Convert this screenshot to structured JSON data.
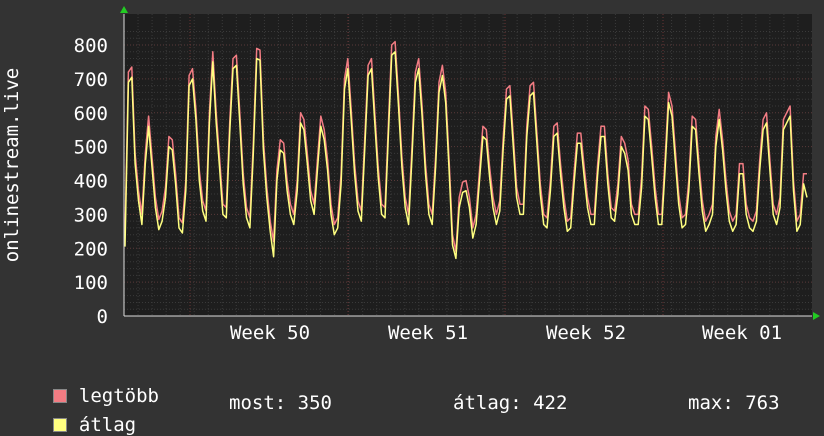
{
  "chart_data": {
    "type": "line",
    "ylabel": "onlinestream.live",
    "ylim": [
      0,
      850
    ],
    "yticks": [
      0,
      100,
      200,
      300,
      400,
      500,
      600,
      700,
      800
    ],
    "xtick_labels": [
      "Week 50",
      "Week 51",
      "Week 52",
      "Week 01"
    ],
    "grid": true,
    "series": [
      {
        "name": "legtöbb",
        "color": "#f27c83",
        "values": [
          245,
          720,
          735,
          480,
          370,
          300,
          480,
          590,
          470,
          350,
          285,
          310,
          380,
          530,
          520,
          420,
          290,
          275,
          400,
          710,
          730,
          610,
          430,
          340,
          310,
          600,
          780,
          600,
          470,
          330,
          320,
          570,
          760,
          770,
          600,
          420,
          320,
          290,
          510,
          790,
          785,
          520,
          380,
          280,
          220,
          430,
          520,
          510,
          400,
          330,
          300,
          400,
          600,
          580,
          480,
          370,
          330,
          460,
          590,
          550,
          460,
          330,
          270,
          290,
          420,
          700,
          760,
          610,
          450,
          340,
          310,
          520,
          740,
          760,
          600,
          440,
          330,
          320,
          560,
          800,
          810,
          650,
          470,
          350,
          300,
          500,
          720,
          760,
          620,
          450,
          330,
          300,
          470,
          690,
          740,
          660,
          460,
          240,
          190,
          350,
          395,
          400,
          350,
          260,
          300,
          430,
          560,
          550,
          440,
          350,
          300,
          340,
          520,
          670,
          680,
          530,
          380,
          330,
          330,
          560,
          680,
          690,
          540,
          390,
          300,
          290,
          400,
          560,
          570,
          450,
          350,
          280,
          290,
          420,
          540,
          540,
          440,
          350,
          300,
          300,
          450,
          560,
          560,
          420,
          320,
          310,
          390,
          530,
          510,
          460,
          330,
          300,
          300,
          410,
          620,
          610,
          500,
          380,
          300,
          300,
          470,
          660,
          620,
          490,
          360,
          290,
          300,
          400,
          590,
          580,
          450,
          340,
          280,
          300,
          330,
          530,
          610,
          520,
          400,
          310,
          280,
          300,
          450,
          450,
          330,
          290,
          280,
          310,
          460,
          580,
          600,
          460,
          330,
          300,
          350,
          580,
          600,
          620,
          400,
          280,
          300,
          420,
          420
        ]
      },
      {
        "name": "átlag",
        "color": "#ffff80",
        "values": [
          205,
          690,
          705,
          450,
          340,
          270,
          450,
          560,
          440,
          320,
          255,
          280,
          350,
          500,
          490,
          390,
          260,
          245,
          370,
          680,
          700,
          580,
          400,
          310,
          280,
          570,
          750,
          570,
          440,
          300,
          290,
          540,
          730,
          740,
          570,
          390,
          290,
          260,
          480,
          760,
          755,
          490,
          350,
          250,
          175,
          400,
          490,
          480,
          370,
          300,
          270,
          370,
          570,
          550,
          450,
          340,
          300,
          430,
          560,
          520,
          430,
          300,
          240,
          260,
          390,
          670,
          730,
          580,
          420,
          310,
          280,
          490,
          710,
          730,
          570,
          410,
          300,
          290,
          530,
          770,
          780,
          620,
          440,
          320,
          270,
          470,
          690,
          730,
          590,
          420,
          300,
          270,
          440,
          660,
          710,
          630,
          430,
          210,
          170,
          320,
          365,
          370,
          320,
          230,
          270,
          400,
          530,
          520,
          410,
          320,
          270,
          310,
          490,
          640,
          650,
          500,
          350,
          300,
          300,
          530,
          650,
          660,
          510,
          360,
          270,
          260,
          370,
          530,
          540,
          420,
          320,
          250,
          260,
          390,
          510,
          510,
          410,
          320,
          270,
          270,
          420,
          530,
          530,
          390,
          290,
          280,
          360,
          500,
          480,
          430,
          300,
          270,
          270,
          380,
          590,
          580,
          470,
          350,
          270,
          270,
          440,
          630,
          590,
          460,
          330,
          260,
          270,
          370,
          560,
          550,
          420,
          310,
          250,
          270,
          300,
          500,
          580,
          490,
          370,
          280,
          250,
          270,
          420,
          420,
          300,
          260,
          250,
          280,
          430,
          550,
          570,
          430,
          300,
          270,
          320,
          550,
          570,
          590,
          370,
          250,
          270,
          390,
          350
        ]
      }
    ],
    "legend": [
      {
        "label": "legtöbb",
        "color": "#f27c83"
      },
      {
        "label": "átlag",
        "color": "#ffff80"
      }
    ]
  },
  "stats": {
    "most": "most: 350",
    "atlag": "átlag: 422",
    "max": "max: 763"
  }
}
